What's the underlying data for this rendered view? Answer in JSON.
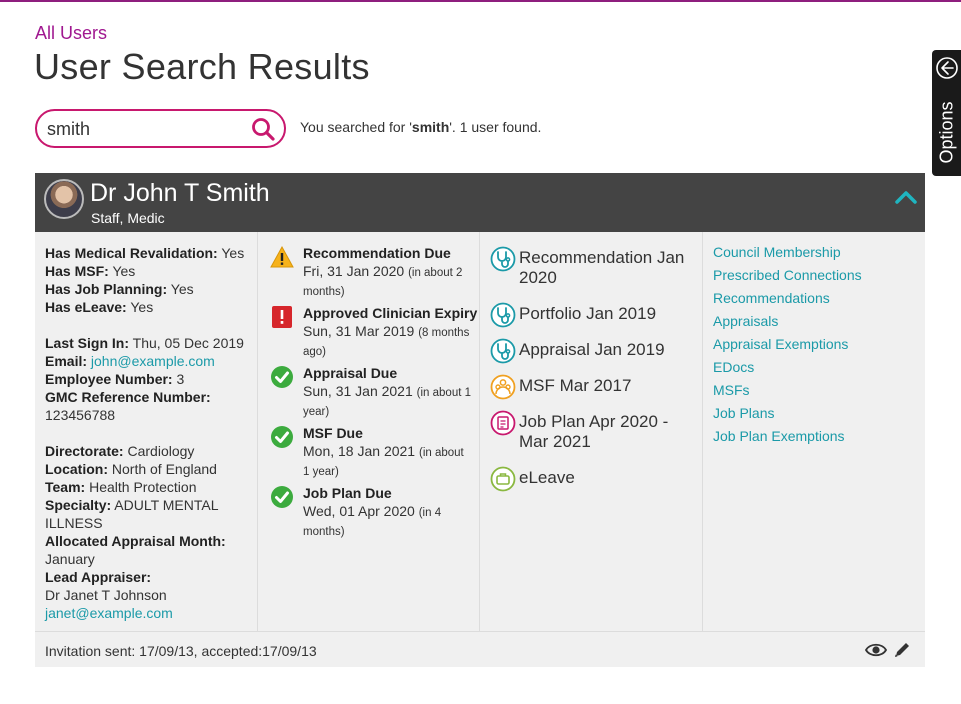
{
  "breadcrumb": "All Users",
  "title": "User Search Results",
  "search": {
    "value": "smith",
    "summary_prefix": "You searched for '",
    "term": "smith",
    "summary_suffix": "'. 1 user found."
  },
  "options": {
    "label": "Options"
  },
  "user": {
    "name": "Dr John T Smith",
    "role": "Staff, Medic",
    "details": {
      "has_revalidation_label": "Has Medical Revalidation:",
      "has_revalidation": "Yes",
      "has_msf_label": "Has MSF:",
      "has_msf": "Yes",
      "has_job_planning_label": "Has Job Planning:",
      "has_job_planning": "Yes",
      "has_eleave_label": "Has eLeave:",
      "has_eleave": "Yes",
      "last_sign_in_label": "Last Sign In:",
      "last_sign_in": "Thu, 05 Dec 2019",
      "email_label": "Email:",
      "email": "john@example.com",
      "employee_number_label": "Employee Number:",
      "employee_number": "3",
      "gmc_label": "GMC Reference Number:",
      "gmc": "123456788",
      "directorate_label": "Directorate:",
      "directorate": "Cardiology",
      "location_label": "Location:",
      "location": "North of England",
      "team_label": "Team:",
      "team": "Health Protection",
      "specialty_label": "Specialty:",
      "specialty": "ADULT MENTAL ILLNESS",
      "appraisal_month_label": "Allocated Appraisal Month:",
      "appraisal_month": "January",
      "lead_appraiser_label": "Lead Appraiser:",
      "lead_appraiser": "Dr Janet T Johnson",
      "lead_appraiser_email": "janet@example.com"
    },
    "alerts": [
      {
        "icon": "warning-icon",
        "title": "Recommendation Due",
        "date": "Fri, 31 Jan 2020",
        "relative": "(in about 2 months)"
      },
      {
        "icon": "error-icon",
        "title": "Approved Clinician Expiry",
        "date": "Sun, 31 Mar 2019",
        "relative": "(8 months ago)"
      },
      {
        "icon": "check-icon",
        "title": "Appraisal Due",
        "date": "Sun, 31 Jan 2021",
        "relative": "(in about 1 year)"
      },
      {
        "icon": "check-icon",
        "title": "MSF Due",
        "date": "Mon, 18 Jan 2021",
        "relative": "(in about 1 year)"
      },
      {
        "icon": "check-icon",
        "title": "Job Plan Due",
        "date": "Wed, 01 Apr 2020",
        "relative": "(in 4 months)"
      }
    ],
    "portfolio": [
      {
        "icon": "stethoscope-icon",
        "label": "Recommendation Jan 2020",
        "color": "#1b9aa8"
      },
      {
        "icon": "stethoscope-icon",
        "label": "Portfolio Jan 2019",
        "color": "#1b9aa8"
      },
      {
        "icon": "stethoscope-icon",
        "label": "Appraisal Jan 2019",
        "color": "#1b9aa8"
      },
      {
        "icon": "people-icon",
        "label": "MSF Mar 2017",
        "color": "#f0a020"
      },
      {
        "icon": "clipboard-icon",
        "label": "Job Plan Apr 2020 - Mar 2021",
        "color": "#c8186e"
      },
      {
        "icon": "suitcase-icon",
        "label": "eLeave",
        "color": "#8ab840"
      }
    ],
    "links": [
      "Council Membership",
      "Prescribed Connections",
      "Recommendations",
      "Appraisals",
      "Appraisal Exemptions",
      "EDocs",
      "MSFs",
      "Job Plans",
      "Job Plan Exemptions"
    ],
    "invitation": "Invitation sent: 17/09/13, accepted:17/09/13"
  },
  "colors": {
    "accent": "#a01890",
    "search_border": "#c8186e",
    "link": "#1b9aa8",
    "header_bg": "#444444",
    "teal_chevron": "#1fb5c0"
  }
}
